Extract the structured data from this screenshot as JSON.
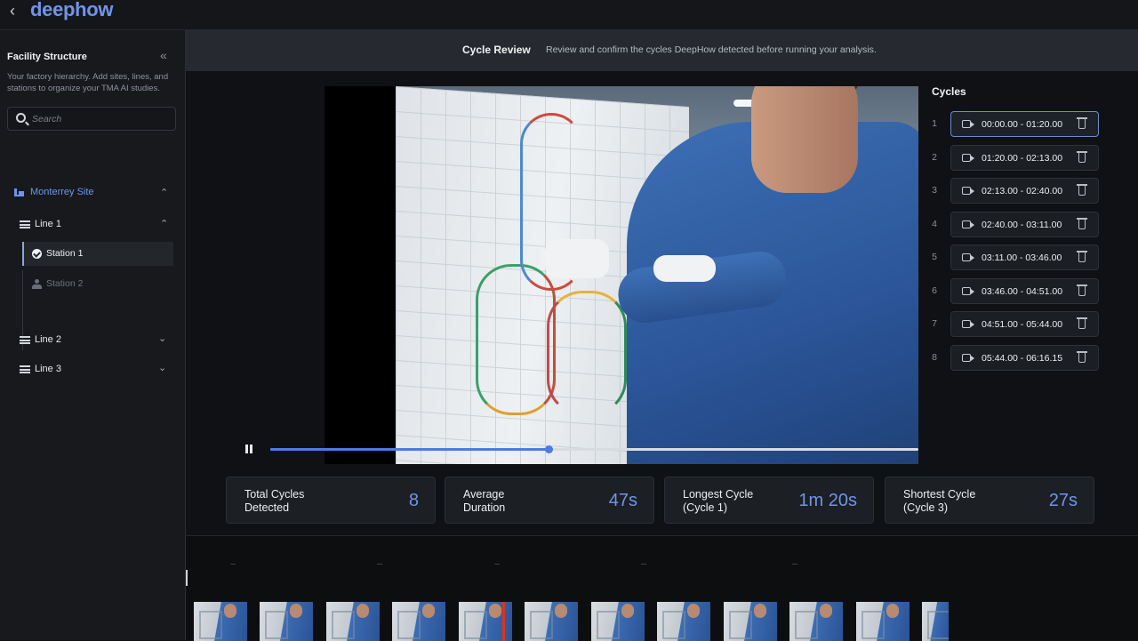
{
  "app": {
    "back_glyph": "‹",
    "logo": "deephow"
  },
  "sidebar": {
    "title": "Facility Structure",
    "collapse_glyph": "«",
    "description": "Your factory hierarchy. Add sites, lines, and stations to organize your TMA AI studies.",
    "search_placeholder": "Search",
    "site": {
      "label": "Monterrey Site",
      "expanded": true
    },
    "lines": [
      {
        "label": "Line 1",
        "expanded": true,
        "stations": [
          {
            "label": "Station 1",
            "selected": true,
            "icon": "check-circle-icon"
          },
          {
            "label": "Station 2",
            "selected": false,
            "icon": "person-icon"
          }
        ]
      },
      {
        "label": "Line 2",
        "expanded": false
      },
      {
        "label": "Line 3",
        "expanded": false
      }
    ]
  },
  "header": {
    "title": "Cycle Review",
    "subtitle": "Review and confirm the cycles DeepHow detected before running your analysis."
  },
  "player": {
    "progress": 0.43,
    "state": "playing"
  },
  "cycles": {
    "title": "Cycles",
    "items": [
      {
        "num": "1",
        "range": "00:00.00  -  01:20.00",
        "selected": true
      },
      {
        "num": "2",
        "range": "01:20.00  -  02:13.00",
        "selected": false
      },
      {
        "num": "3",
        "range": "02:13.00  -  02:40.00",
        "selected": false
      },
      {
        "num": "4",
        "range": "02:40.00  -  03:11.00",
        "selected": false
      },
      {
        "num": "5",
        "range": "03:11.00  -  03:46.00",
        "selected": false
      },
      {
        "num": "6",
        "range": "03:46.00  -  04:51.00",
        "selected": false
      },
      {
        "num": "7",
        "range": "04:51.00  -  05:44.00",
        "selected": false
      },
      {
        "num": "8",
        "range": "05:44.00  -  06:16.15",
        "selected": false
      }
    ]
  },
  "stats": [
    {
      "label": "Total Cycles\nDetected",
      "value": "8"
    },
    {
      "label": "Average\nDuration",
      "value": "47s"
    },
    {
      "label": "Longest Cycle\n(Cycle 1)",
      "value": "1m 20s"
    },
    {
      "label": "Shortest Cycle\n(Cycle 3)",
      "value": "27s"
    }
  ],
  "colors": {
    "accent": "#6f95ea",
    "progress": "#4b7be6",
    "playhead": "#e0321f",
    "background": "#0f1114"
  }
}
